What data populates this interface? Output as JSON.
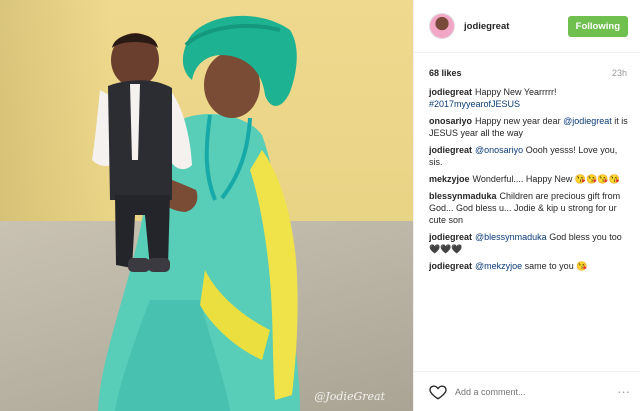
{
  "photo": {
    "watermark": "@JodieGreat"
  },
  "header": {
    "username": "jodiegreat",
    "follow_label": "Following"
  },
  "meta": {
    "likes": "68 likes",
    "time": "23h"
  },
  "comments": [
    {
      "user": "jodiegreat",
      "parts": [
        {
          "text": "Happy New Yearrrrr! "
        },
        {
          "text": "#2017myyearofJESUS",
          "link": true
        }
      ]
    },
    {
      "user": "onosariyo",
      "parts": [
        {
          "text": "Happy new year dear "
        },
        {
          "text": "@jodiegreat",
          "link": true
        },
        {
          "text": " it is JESUS year all the way"
        }
      ]
    },
    {
      "user": "jodiegreat",
      "parts": [
        {
          "text": "@onosariyo",
          "link": true
        },
        {
          "text": " Oooh yesss! Love you, sis."
        }
      ]
    },
    {
      "user": "mekzyjoe",
      "parts": [
        {
          "text": "Wonderful.... Happy New 😘😘😘😘"
        }
      ]
    },
    {
      "user": "blessynmaduka",
      "parts": [
        {
          "text": "Children are precious gift from God... God bless u... Jodie & kip u strong for ur cute son"
        }
      ]
    },
    {
      "user": "jodiegreat",
      "parts": [
        {
          "text": "@blessynmaduka",
          "link": true
        },
        {
          "text": " God bless you too 🖤🖤🖤"
        }
      ]
    },
    {
      "user": "jodiegreat",
      "parts": [
        {
          "text": "@mekzyjoe",
          "link": true
        },
        {
          "text": " same to you 😘"
        }
      ]
    }
  ],
  "footer": {
    "add_comment_placeholder": "Add a comment...",
    "more_label": "···"
  },
  "colors": {
    "follow_button": "#70c050",
    "link": "#0c3c77"
  }
}
